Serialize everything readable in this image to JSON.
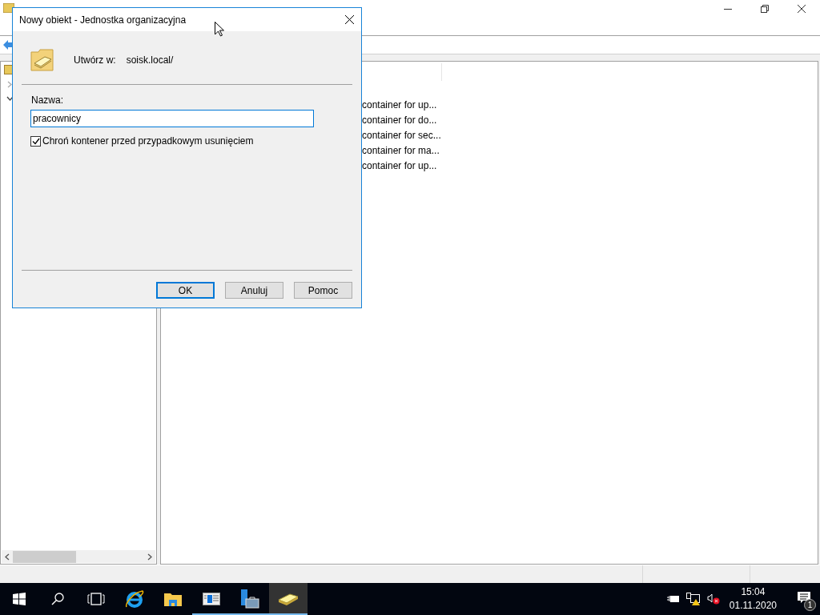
{
  "app": {
    "rows": [
      {
        "description": "container for up..."
      },
      {
        "description": "container for do..."
      },
      {
        "description": "container for sec..."
      },
      {
        "description": "container for ma..."
      },
      {
        "description": "container for up..."
      }
    ]
  },
  "dialog": {
    "title": "Nowy obiekt - Jednostka organizacyjna",
    "create_in_label": "Utwórz w:",
    "create_in_value": "soisk.local/",
    "name_label": "Nazwa:",
    "name_value": "pracownicy",
    "protect": {
      "label": "Chroń kontener przed przypadkowym usunięciem",
      "checked": true
    },
    "buttons": [
      {
        "label": "OK",
        "default": true
      },
      {
        "label": "Anuluj",
        "default": false
      },
      {
        "label": "Pomoc",
        "default": false
      }
    ]
  },
  "taskbar": {
    "apps": [
      {
        "kind": "ie",
        "running": false,
        "active": false
      },
      {
        "kind": "explorer",
        "running": false,
        "active": false
      },
      {
        "kind": "panel",
        "running": true,
        "active": false
      },
      {
        "kind": "server",
        "running": true,
        "active": false
      },
      {
        "kind": "aduc",
        "running": true,
        "active": true
      }
    ],
    "time": "15:04",
    "date": "01.11.2020",
    "notifications": "1"
  }
}
